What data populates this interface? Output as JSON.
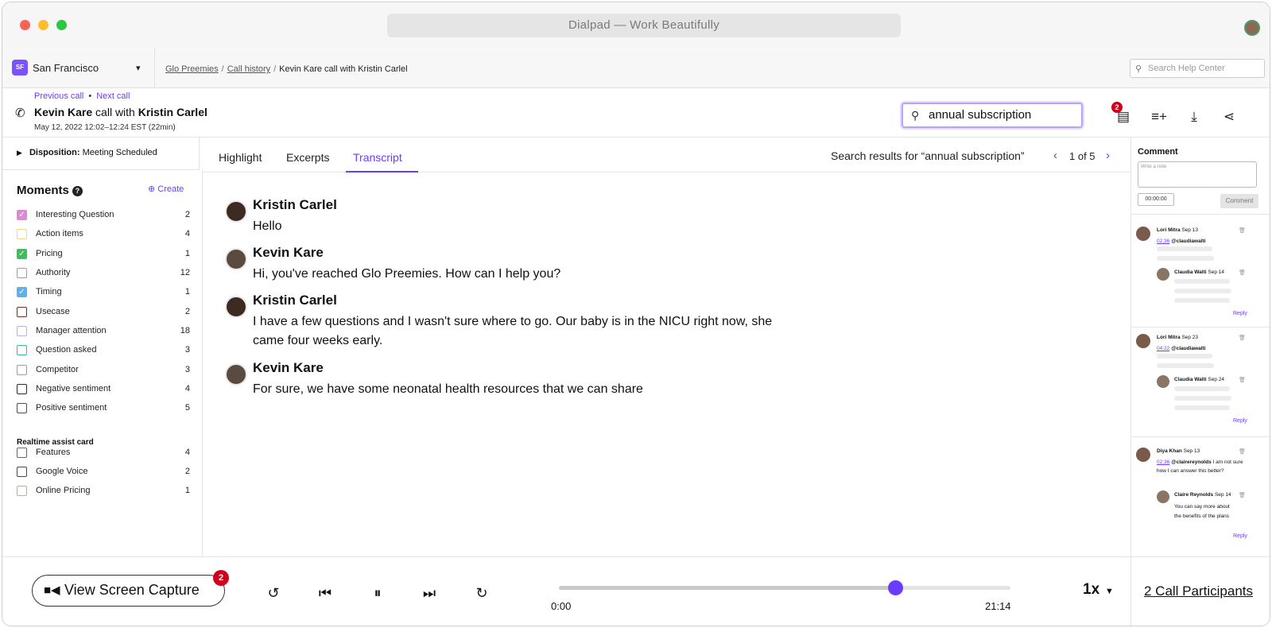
{
  "window": {
    "title": "Dialpad — Work Beautifully"
  },
  "colors": {
    "accent": "#6b3cff",
    "badge": "#d0021b"
  },
  "nav": {
    "location_badge": "SF",
    "location": "San Francisco",
    "breadcrumbs": [
      "Glo Preemies",
      "Call history",
      "Kevin Kare call with Kristin Carlel"
    ],
    "help_search_placeholder": "Search Help Center"
  },
  "call": {
    "prev_label": "Previous call",
    "next_label": "Next call",
    "agent": "Kevin Kare",
    "with_text": "call with",
    "customer": "Kristin Carlel",
    "date": "May 12, 2022 12:02–12:24 EST  (22min)",
    "search_value": "annual subscription",
    "notification_count": "2"
  },
  "disposition": {
    "label": "Disposition:",
    "value": "Meeting Scheduled"
  },
  "moments": {
    "title": "Moments",
    "create_label": "Create",
    "items": [
      {
        "label": "Interesting Question",
        "count": "2",
        "color": "#d98bd6",
        "checked": true
      },
      {
        "label": "Action items",
        "count": "4",
        "color": "#f3d58a",
        "checked": false
      },
      {
        "label": "Pricing",
        "count": "1",
        "color": "#3fbf5a",
        "checked": true
      },
      {
        "label": "Authority",
        "count": "12",
        "color": "#ef7b7b",
        "checked": false
      },
      {
        "label": "Timing",
        "count": "1",
        "color": "#5fb1ee",
        "checked": true
      },
      {
        "label": "Usecase",
        "count": "2",
        "color": "#7a2e22",
        "checked": false
      },
      {
        "label": "Manager attention",
        "count": "18",
        "color": "#b9b0f0",
        "checked": false
      },
      {
        "label": "Question asked",
        "count": "3",
        "color": "#2fbfa2",
        "checked": false
      },
      {
        "label": "Competitor",
        "count": "3",
        "color": "#ef7b7b",
        "checked": false
      },
      {
        "label": "Negative sentiment",
        "count": "4",
        "color": "#1d1aa6",
        "checked": false
      },
      {
        "label": "Positive sentiment",
        "count": "5",
        "color": "#8c2a7a",
        "checked": false
      }
    ],
    "realtime_title": "Realtime assist card",
    "realtime_items": [
      {
        "label": "Features",
        "count": "4",
        "color": "#1f8a6a"
      },
      {
        "label": "Google Voice",
        "count": "2",
        "color": "#9a2530"
      },
      {
        "label": "Online Pricing",
        "count": "1",
        "color": "#e8b020"
      }
    ]
  },
  "tabs": [
    "Highlight",
    "Excerpts",
    "Transcript"
  ],
  "search_results": {
    "text": "Search results for “annual subscription”",
    "page": "1 of 5"
  },
  "transcript": [
    {
      "speaker": "Kristin Carlel",
      "text": "Hello"
    },
    {
      "speaker": "Kevin Kare",
      "text": "Hi, you've reached Glo Preemies. How can I help you?"
    },
    {
      "speaker": "Kristin Carlel",
      "text": "I have a few questions and I wasn't sure where to go. Our baby is in the NICU right now, she came four weeks early."
    },
    {
      "speaker": "Kevin Kare",
      "text": "For sure, we have some neonatal health resources that we can share"
    }
  ],
  "comments": {
    "title": "Comment",
    "input_placeholder": "Write a note",
    "time_value": "00:00:00",
    "button_label": "Comment",
    "reply_label": "Reply",
    "threads": [
      {
        "author": "Lori Mitra",
        "date": "Sep 13",
        "ts": "02:36",
        "mention": "@claudiawalti",
        "text": "",
        "reply_author": "Claudia Walti",
        "reply_date": "Sep 14",
        "reply_text": ""
      },
      {
        "author": "Lori Mitra",
        "date": "Sep 23",
        "ts": "04:22",
        "mention": "@claudiawalti",
        "text": "",
        "reply_author": "Claudia Walti",
        "reply_date": "Sep 24",
        "reply_text": ""
      },
      {
        "author": "Diya Khan",
        "date": "Sep 13",
        "ts": "02:36",
        "mention": "@clairereynolds",
        "text": " I am not sure how I can answer this better?",
        "reply_author": "Claire Reynolds",
        "reply_date": "Sep 14",
        "reply_text": "You can say more about the benefits of the plans"
      }
    ]
  },
  "player": {
    "screen_capture_label": "View Screen Capture",
    "screen_capture_badge": "2",
    "progress": 0.745,
    "time_start": "0:00",
    "time_end": "21:14",
    "speed": "1x",
    "participants_label": "2 Call Participants"
  }
}
